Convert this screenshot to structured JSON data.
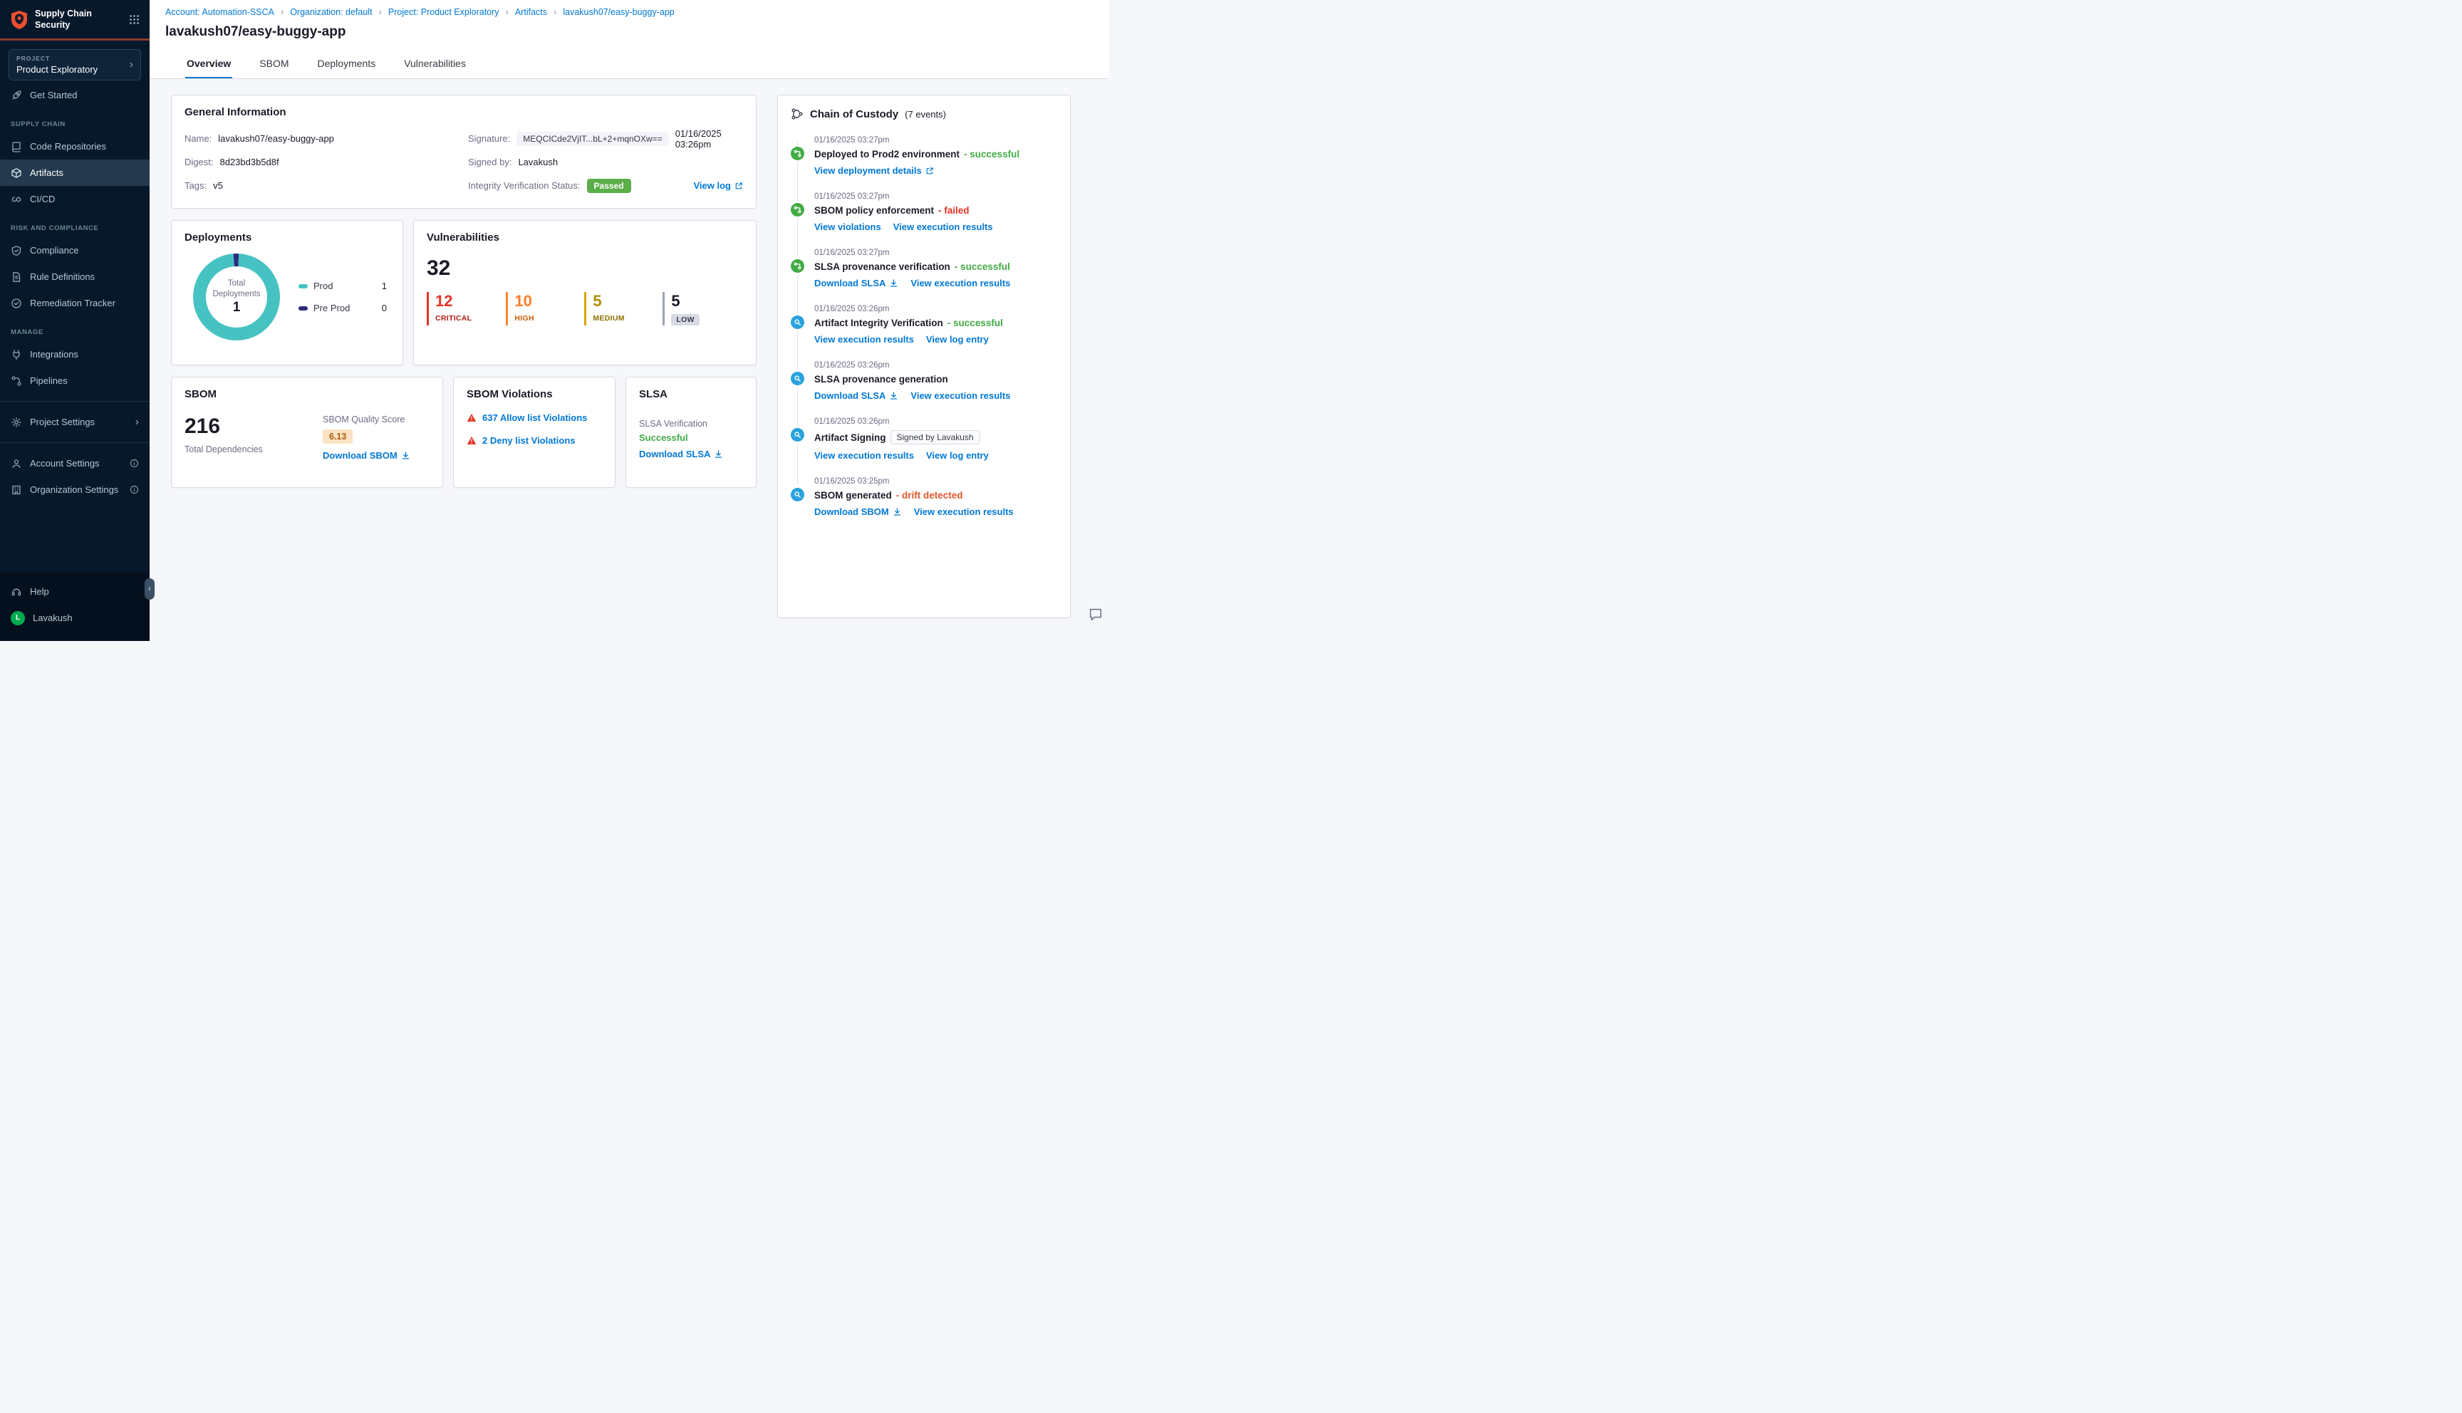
{
  "colors": {
    "accent_blue": "#0278D5",
    "success_green": "#42AB45",
    "error_red": "#E43326",
    "drift_orange": "#E4572E",
    "high_orange": "#FF7B26",
    "medium_yellow": "#B28B00",
    "donut_teal": "#47C2C2",
    "preprod_purple": "#2F2B7E",
    "sidebar_bg": "#07182B",
    "passed_badge_green": "#5BAE48"
  },
  "icons": {
    "chevron_right": "›",
    "chevron_left": "‹"
  },
  "sidebar": {
    "app_title": "Supply Chain Security",
    "project_label": "PROJECT",
    "project_name": "Product Exploratory",
    "nav": {
      "get_started": "Get Started",
      "section_supply_chain": "SUPPLY CHAIN",
      "code_repositories": "Code Repositories",
      "artifacts": "Artifacts",
      "cicd": "CI/CD",
      "section_risk": "RISK AND COMPLIANCE",
      "compliance": "Compliance",
      "rule_definitions": "Rule Definitions",
      "remediation_tracker": "Remediation Tracker",
      "section_manage": "MANAGE",
      "integrations": "Integrations",
      "pipelines": "Pipelines",
      "project_settings": "Project Settings",
      "account_settings": "Account Settings",
      "organization_settings": "Organization Settings",
      "help": "Help"
    },
    "user": {
      "initial": "L",
      "name": "Lavakush"
    }
  },
  "breadcrumbs": [
    "Account: Automation-SSCA",
    "Organization: default",
    "Project: Product Exploratory",
    "Artifacts",
    "lavakush07/easy-buggy-app"
  ],
  "page_title": "lavakush07/easy-buggy-app",
  "tabs": [
    "Overview",
    "SBOM",
    "Deployments",
    "Vulnerabilities"
  ],
  "general_info": {
    "title": "General Information",
    "name_label": "Name:",
    "name": "lavakush07/easy-buggy-app",
    "digest_label": "Digest:",
    "digest": "8d23bd3b5d8f",
    "tags_label": "Tags:",
    "tags": "v5",
    "signature_label": "Signature:",
    "signature": "MEQCICde2VjIT...bL+2+mqnOXw==",
    "signature_time": "01/16/2025 03:26pm",
    "signed_by_label": "Signed by:",
    "signed_by": "Lavakush",
    "integrity_label": "Integrity Verification Status:",
    "integrity_status": "Passed",
    "view_log": "View log"
  },
  "deployments_card": {
    "title": "Deployments",
    "center_label": "Total Deployments",
    "center_value": "1",
    "legend": [
      {
        "label": "Prod",
        "value": "1",
        "color": "#47C2C2"
      },
      {
        "label": "Pre Prod",
        "value": "0",
        "color": "#2F2B7E"
      }
    ]
  },
  "chart_data": {
    "type": "pie",
    "title": "Deployments",
    "categories": [
      "Prod",
      "Pre Prod"
    ],
    "values": [
      1,
      0
    ],
    "center_label": "Total Deployments",
    "center_value": 1,
    "legend_position": "right"
  },
  "vulnerabilities_card": {
    "title": "Vulnerabilities",
    "total": "32",
    "severities": [
      {
        "count": "12",
        "label": "CRITICAL"
      },
      {
        "count": "10",
        "label": "HIGH"
      },
      {
        "count": "5",
        "label": "MEDIUM"
      },
      {
        "count": "5",
        "label": "LOW"
      }
    ]
  },
  "sbom_card": {
    "title": "SBOM",
    "total": "216",
    "total_label": "Total Dependencies",
    "quality_label": "SBOM Quality Score",
    "quality_score": "6.13",
    "download": "Download SBOM"
  },
  "sbom_violations_card": {
    "title": "SBOM Violations",
    "allow": "637 Allow list Violations",
    "deny": "2 Deny list Violations"
  },
  "slsa_card": {
    "title": "SLSA",
    "verification_label": "SLSA Verification",
    "status": "Successful",
    "download": "Download SLSA"
  },
  "chain_of_custody": {
    "title": "Chain of Custody",
    "count": "(7 events)",
    "events": [
      {
        "time": "01/16/2025 03:27pm",
        "title": "Deployed to Prod2 environment",
        "status": "- successful",
        "links": [
          "View deployment details"
        ]
      },
      {
        "time": "01/16/2025 03:27pm",
        "title": "SBOM policy enforcement",
        "status": "- failed",
        "links": [
          "View violations",
          "View execution results"
        ]
      },
      {
        "time": "01/16/2025 03:27pm",
        "title": "SLSA provenance verification",
        "status": "- successful",
        "links": [
          "Download SLSA",
          "View execution results"
        ]
      },
      {
        "time": "01/16/2025 03:26pm",
        "title": "Artifact Integrity Verification",
        "status": "- successful",
        "links": [
          "View execution results",
          "View log entry"
        ]
      },
      {
        "time": "01/16/2025 03:26pm",
        "title": "SLSA provenance generation",
        "status": "",
        "links": [
          "Download SLSA",
          "View execution results"
        ]
      },
      {
        "time": "01/16/2025 03:26pm",
        "title": "Artifact Signing",
        "status": "",
        "badge": "Signed by Lavakush",
        "links": [
          "View execution results",
          "View log entry"
        ]
      },
      {
        "time": "01/16/2025 03:25pm",
        "title": "SBOM generated",
        "status": "- drift detected",
        "links": [
          "Download SBOM",
          "View execution results"
        ]
      }
    ]
  }
}
